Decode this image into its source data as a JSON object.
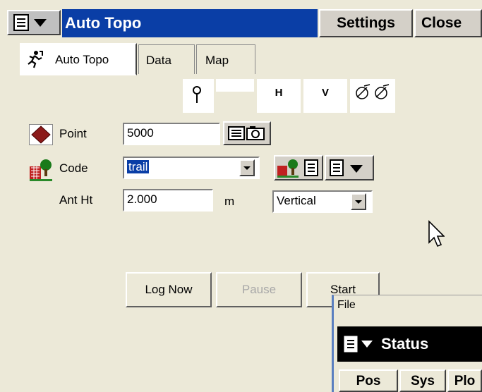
{
  "titlebar": {
    "title": "Auto Topo",
    "settings_label": "Settings",
    "close_label": "Close",
    "menu_icon": "menu-list-icon",
    "title_color": "#0a3ea6"
  },
  "tabs": [
    {
      "label": "Auto Topo",
      "icon": "running-man-icon"
    },
    {
      "label": "Data"
    },
    {
      "label": "Map"
    }
  ],
  "status_header": {
    "h_label": "H",
    "v_label": "V"
  },
  "form": {
    "point_label": "Point",
    "point_value": "5000",
    "code_label": "Code",
    "code_value": "trail",
    "ant_ht_label": "Ant Ht",
    "ant_ht_value": "2.000",
    "ant_ht_unit": "m",
    "measure_method": "Vertical"
  },
  "buttons": {
    "log_now": "Log Now",
    "pause": "Pause",
    "start": "Start"
  },
  "status_window": {
    "file_menu": "File",
    "title": "Status",
    "tabs": [
      "Pos",
      "Sys",
      "Plo"
    ]
  }
}
